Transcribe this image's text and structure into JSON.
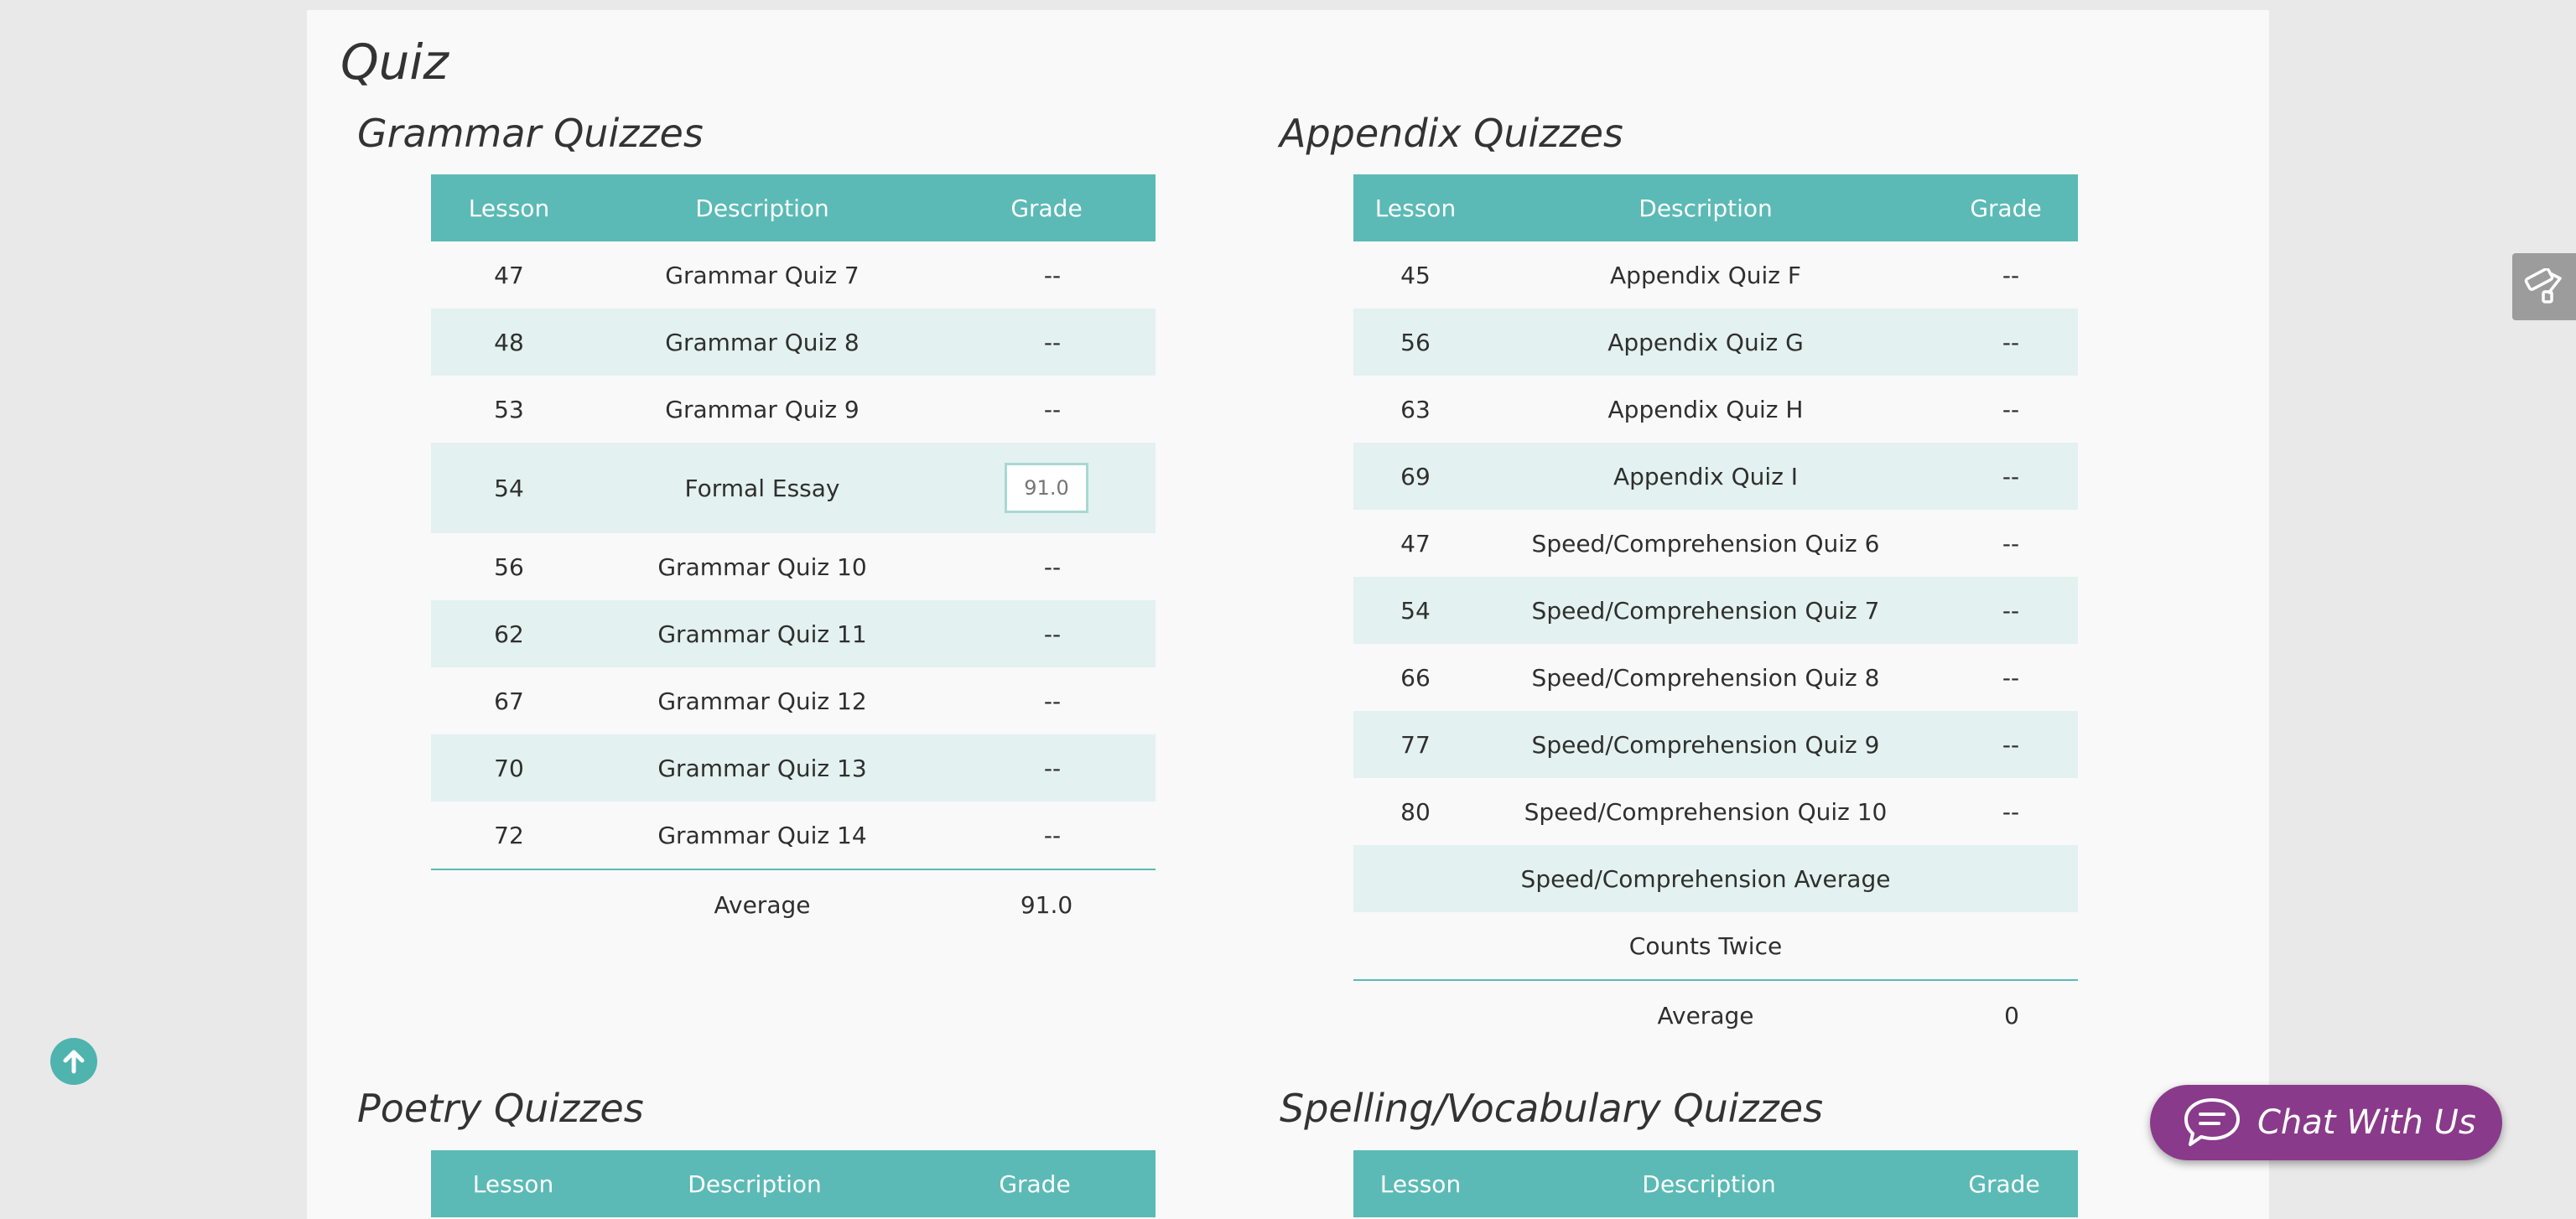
{
  "page": {
    "title": "Quiz"
  },
  "grammar": {
    "title": "Grammar Quizzes",
    "headers": {
      "lesson": "Lesson",
      "description": "Description",
      "grade": "Grade"
    },
    "rows": [
      {
        "lesson": "47",
        "description": "Grammar Quiz 7",
        "grade": "--"
      },
      {
        "lesson": "48",
        "description": "Grammar Quiz 8",
        "grade": "--"
      },
      {
        "lesson": "53",
        "description": "Grammar Quiz 9",
        "grade": "--"
      },
      {
        "lesson": "54",
        "description": "Formal Essay",
        "grade_input_placeholder": "91.0"
      },
      {
        "lesson": "56",
        "description": "Grammar Quiz 10",
        "grade": "--"
      },
      {
        "lesson": "62",
        "description": "Grammar Quiz 11",
        "grade": "--"
      },
      {
        "lesson": "67",
        "description": "Grammar Quiz 12",
        "grade": "--"
      },
      {
        "lesson": "70",
        "description": "Grammar Quiz 13",
        "grade": "--"
      },
      {
        "lesson": "72",
        "description": "Grammar Quiz 14",
        "grade": "--"
      }
    ],
    "average_label": "Average",
    "average_value": "91.0"
  },
  "appendix": {
    "title": "Appendix Quizzes",
    "headers": {
      "lesson": "Lesson",
      "description": "Description",
      "grade": "Grade"
    },
    "rows": [
      {
        "lesson": "45",
        "description": "Appendix Quiz F",
        "grade": "--"
      },
      {
        "lesson": "56",
        "description": "Appendix Quiz G",
        "grade": "--"
      },
      {
        "lesson": "63",
        "description": "Appendix Quiz H",
        "grade": "--"
      },
      {
        "lesson": "69",
        "description": "Appendix Quiz I",
        "grade": "--"
      },
      {
        "lesson": "47",
        "description": "Speed/Comprehension Quiz 6",
        "grade": "--"
      },
      {
        "lesson": "54",
        "description": "Speed/Comprehension Quiz 7",
        "grade": "--"
      },
      {
        "lesson": "66",
        "description": "Speed/Comprehension Quiz 8",
        "grade": "--"
      },
      {
        "lesson": "77",
        "description": "Speed/Comprehension Quiz 9",
        "grade": "--"
      },
      {
        "lesson": "80",
        "description": "Speed/Comprehension Quiz 10",
        "grade": "--"
      }
    ],
    "speed_average_label": "Speed/Comprehension Average",
    "counts_twice_label": "Counts Twice",
    "average_label": "Average",
    "average_value": "0"
  },
  "poetry": {
    "title": "Poetry Quizzes",
    "headers": {
      "lesson": "Lesson",
      "description": "Description",
      "grade": "Grade"
    }
  },
  "spelling": {
    "title": "Spelling/Vocabulary Quizzes",
    "headers": {
      "lesson": "Lesson",
      "description": "Description",
      "grade": "Grade"
    }
  },
  "chat": {
    "label": "Chat With Us"
  },
  "icons": {
    "side_tool": "paint-roller-icon",
    "scroll_top": "arrow-up-circle-icon",
    "chat": "chat-bubble-icon"
  },
  "colors": {
    "table_header": "#5bbab5",
    "row_alt": "#e3f1f0",
    "chat_button": "#8a3a8a",
    "scroll_top": "#4fb3ae"
  }
}
